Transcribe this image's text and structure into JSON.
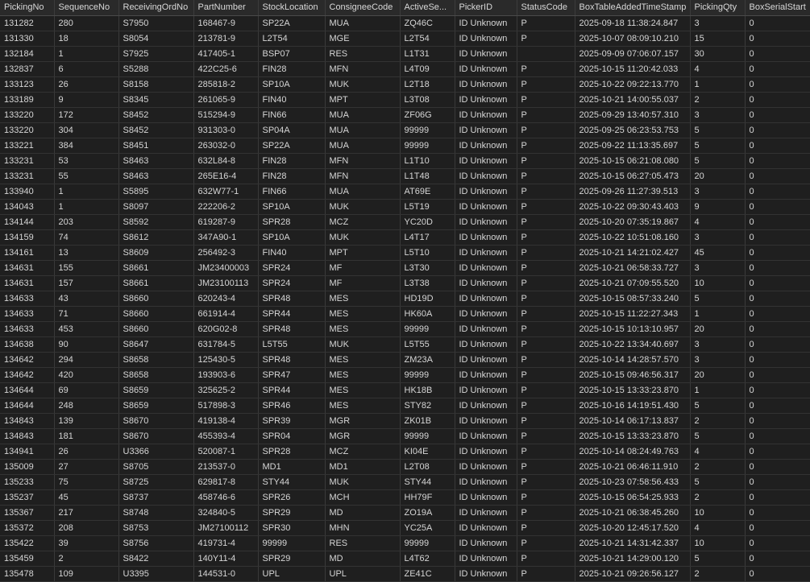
{
  "columns": [
    "PickingNo",
    "SequenceNo",
    "ReceivingOrdNo",
    "PartNumber",
    "StockLocation",
    "ConsigneeCode",
    "ActiveSe...",
    "PickerID",
    "StatusCode",
    "BoxTableAddedTimeStamp",
    "PickingQty",
    "BoxSerialStart"
  ],
  "rows": [
    [
      "131282",
      "280",
      "S7950",
      "168467-9",
      "SP22A",
      "MUA",
      "ZQ46C",
      "ID Unknown",
      "P",
      "2025-09-18 11:38:24.847",
      "3",
      "0"
    ],
    [
      "131330",
      "18",
      "S8054",
      "213781-9",
      "L2T54",
      "MGE",
      "L2T54",
      "ID Unknown",
      "P",
      "2025-10-07 08:09:10.210",
      "15",
      "0"
    ],
    [
      "132184",
      "1",
      "S7925",
      "417405-1",
      "BSP07",
      "RES",
      "L1T31",
      "ID Unknown",
      "",
      "2025-09-09 07:06:07.157",
      "30",
      "0"
    ],
    [
      "132837",
      "6",
      "S5288",
      "422C25-6",
      "FIN28",
      "MFN",
      "L4T09",
      "ID Unknown",
      "P",
      "2025-10-15 11:20:42.033",
      "4",
      "0"
    ],
    [
      "133123",
      "26",
      "S8158",
      "285818-2",
      "SP10A",
      "MUK",
      "L2T18",
      "ID Unknown",
      "P",
      "2025-10-22 09:22:13.770",
      "1",
      "0"
    ],
    [
      "133189",
      "9",
      "S8345",
      "261065-9",
      "FIN40",
      "MPT",
      "L3T08",
      "ID Unknown",
      "P",
      "2025-10-21 14:00:55.037",
      "2",
      "0"
    ],
    [
      "133220",
      "172",
      "S8452",
      "515294-9",
      "FIN66",
      "MUA",
      "ZF06G",
      "ID Unknown",
      "P",
      "2025-09-29 13:40:57.310",
      "3",
      "0"
    ],
    [
      "133220",
      "304",
      "S8452",
      "931303-0",
      "SP04A",
      "MUA",
      "99999",
      "ID Unknown",
      "P",
      "2025-09-25 06:23:53.753",
      "5",
      "0"
    ],
    [
      "133221",
      "384",
      "S8451",
      "263032-0",
      "SP22A",
      "MUA",
      "99999",
      "ID Unknown",
      "P",
      "2025-09-22 11:13:35.697",
      "5",
      "0"
    ],
    [
      "133231",
      "53",
      "S8463",
      "632L84-8",
      "FIN28",
      "MFN",
      "L1T10",
      "ID Unknown",
      "P",
      "2025-10-15 06:21:08.080",
      "5",
      "0"
    ],
    [
      "133231",
      "55",
      "S8463",
      "265E16-4",
      "FIN28",
      "MFN",
      "L1T48",
      "ID Unknown",
      "P",
      "2025-10-15 06:27:05.473",
      "20",
      "0"
    ],
    [
      "133940",
      "1",
      "S5895",
      "632W77-1",
      "FIN66",
      "MUA",
      "AT69E",
      "ID Unknown",
      "P",
      "2025-09-26 11:27:39.513",
      "3",
      "0"
    ],
    [
      "134043",
      "1",
      "S8097",
      "222206-2",
      "SP10A",
      "MUK",
      "L5T19",
      "ID Unknown",
      "P",
      "2025-10-22 09:30:43.403",
      "9",
      "0"
    ],
    [
      "134144",
      "203",
      "S8592",
      "619287-9",
      "SPR28",
      "MCZ",
      "YC20D",
      "ID Unknown",
      "P",
      "2025-10-20 07:35:19.867",
      "4",
      "0"
    ],
    [
      "134159",
      "74",
      "S8612",
      "347A90-1",
      "SP10A",
      "MUK",
      "L4T17",
      "ID Unknown",
      "P",
      "2025-10-22 10:51:08.160",
      "3",
      "0"
    ],
    [
      "134161",
      "13",
      "S8609",
      "256492-3",
      "FIN40",
      "MPT",
      "L5T10",
      "ID Unknown",
      "P",
      "2025-10-21 14:21:02.427",
      "45",
      "0"
    ],
    [
      "134631",
      "155",
      "S8661",
      "JM23400003",
      "SPR24",
      "MF",
      "L3T30",
      "ID Unknown",
      "P",
      "2025-10-21 06:58:33.727",
      "3",
      "0"
    ],
    [
      "134631",
      "157",
      "S8661",
      "JM23100113",
      "SPR24",
      "MF",
      "L3T38",
      "ID Unknown",
      "P",
      "2025-10-21 07:09:55.520",
      "10",
      "0"
    ],
    [
      "134633",
      "43",
      "S8660",
      "620243-4",
      "SPR48",
      "MES",
      "HD19D",
      "ID Unknown",
      "P",
      "2025-10-15 08:57:33.240",
      "5",
      "0"
    ],
    [
      "134633",
      "71",
      "S8660",
      "661914-4",
      "SPR44",
      "MES",
      "HK60A",
      "ID Unknown",
      "P",
      "2025-10-15 11:22:27.343",
      "1",
      "0"
    ],
    [
      "134633",
      "453",
      "S8660",
      "620G02-8",
      "SPR48",
      "MES",
      "99999",
      "ID Unknown",
      "P",
      "2025-10-15 10:13:10.957",
      "20",
      "0"
    ],
    [
      "134638",
      "90",
      "S8647",
      "631784-5",
      "L5T55",
      "MUK",
      "L5T55",
      "ID Unknown",
      "P",
      "2025-10-22 13:34:40.697",
      "3",
      "0"
    ],
    [
      "134642",
      "294",
      "S8658",
      "125430-5",
      "SPR48",
      "MES",
      "ZM23A",
      "ID Unknown",
      "P",
      "2025-10-14 14:28:57.570",
      "3",
      "0"
    ],
    [
      "134642",
      "420",
      "S8658",
      "193903-6",
      "SPR47",
      "MES",
      "99999",
      "ID Unknown",
      "P",
      "2025-10-15 09:46:56.317",
      "20",
      "0"
    ],
    [
      "134644",
      "69",
      "S8659",
      "325625-2",
      "SPR44",
      "MES",
      "HK18B",
      "ID Unknown",
      "P",
      "2025-10-15 13:33:23.870",
      "1",
      "0"
    ],
    [
      "134644",
      "248",
      "S8659",
      "517898-3",
      "SPR46",
      "MES",
      "STY82",
      "ID Unknown",
      "P",
      "2025-10-16 14:19:51.430",
      "5",
      "0"
    ],
    [
      "134843",
      "139",
      "S8670",
      "419138-4",
      "SPR39",
      "MGR",
      "ZK01B",
      "ID Unknown",
      "P",
      "2025-10-14 06:17:13.837",
      "2",
      "0"
    ],
    [
      "134843",
      "181",
      "S8670",
      "455393-4",
      "SPR04",
      "MGR",
      "99999",
      "ID Unknown",
      "P",
      "2025-10-15 13:33:23.870",
      "5",
      "0"
    ],
    [
      "134941",
      "26",
      "U3366",
      "520087-1",
      "SPR28",
      "MCZ",
      "KI04E",
      "ID Unknown",
      "P",
      "2025-10-14 08:24:49.763",
      "4",
      "0"
    ],
    [
      "135009",
      "27",
      "S8705",
      "213537-0",
      "MD1",
      "MD1",
      "L2T08",
      "ID Unknown",
      "P",
      "2025-10-21 06:46:11.910",
      "2",
      "0"
    ],
    [
      "135233",
      "75",
      "S8725",
      "629817-8",
      "STY44",
      "MUK",
      "STY44",
      "ID Unknown",
      "P",
      "2025-10-23 07:58:56.433",
      "5",
      "0"
    ],
    [
      "135237",
      "45",
      "S8737",
      "458746-6",
      "SPR26",
      "MCH",
      "HH79F",
      "ID Unknown",
      "P",
      "2025-10-15 06:54:25.933",
      "2",
      "0"
    ],
    [
      "135367",
      "217",
      "S8748",
      "324840-5",
      "SPR29",
      "MD",
      "ZO19A",
      "ID Unknown",
      "P",
      "2025-10-21 06:38:45.260",
      "10",
      "0"
    ],
    [
      "135372",
      "208",
      "S8753",
      "JM27100112",
      "SPR30",
      "MHN",
      "YC25A",
      "ID Unknown",
      "P",
      "2025-10-20 12:45:17.520",
      "4",
      "0"
    ],
    [
      "135422",
      "39",
      "S8756",
      "419731-4",
      "99999",
      "RES",
      "99999",
      "ID Unknown",
      "P",
      "2025-10-21 14:31:42.337",
      "10",
      "0"
    ],
    [
      "135459",
      "2",
      "S8422",
      "140Y11-4",
      "SPR29",
      "MD",
      "L4T62",
      "ID Unknown",
      "P",
      "2025-10-21 14:29:00.120",
      "5",
      "0"
    ],
    [
      "135478",
      "109",
      "U3395",
      "144531-0",
      "UPL",
      "UPL",
      "ZE41C",
      "ID Unknown",
      "P",
      "2025-10-21 09:26:56.127",
      "2",
      "0"
    ]
  ]
}
